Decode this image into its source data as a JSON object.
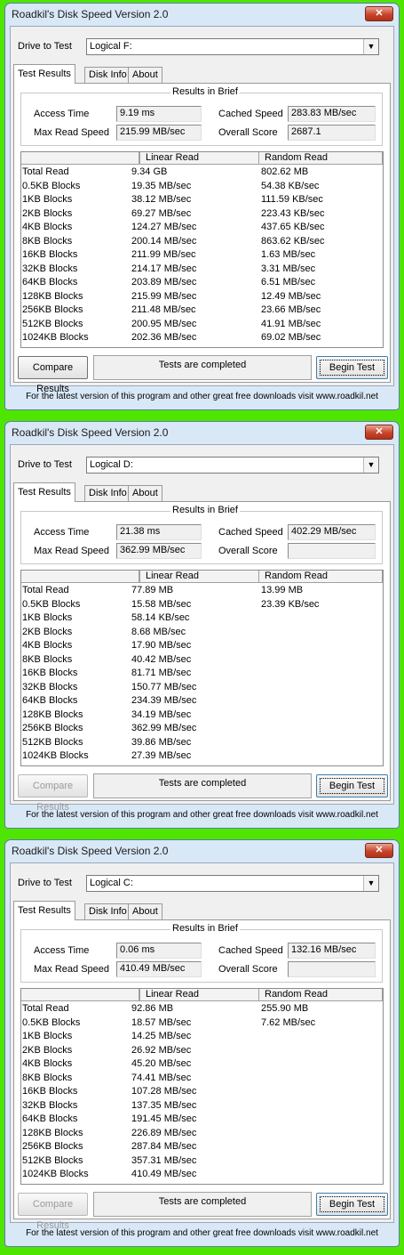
{
  "windows": [
    {
      "title": "Roadkil's Disk Speed Version 2.0",
      "close_icon": "close-x-icon",
      "drive_label": "Drive to Test",
      "drive_value": "Logical F:",
      "tabs": [
        "Test Results",
        "Disk Info",
        "About"
      ],
      "brief_title": "Results in Brief",
      "access_time_label": "Access Time",
      "access_time": "9.19 ms",
      "cached_speed_label": "Cached Speed",
      "cached_speed": "283.83 MB/sec",
      "max_read_label": "Max Read Speed",
      "max_read": "215.99 MB/sec",
      "overall_score_label": "Overall Score",
      "overall_score": "2687.1",
      "columns": [
        "",
        "Linear Read",
        "Random Read"
      ],
      "rows": [
        [
          "Total Read",
          "9.34 GB",
          "802.62 MB"
        ],
        [
          "0.5KB Blocks",
          "19.35 MB/sec",
          "54.38 KB/sec"
        ],
        [
          "1KB Blocks",
          "38.12 MB/sec",
          "111.59 KB/sec"
        ],
        [
          "2KB Blocks",
          "69.27 MB/sec",
          "223.43 KB/sec"
        ],
        [
          "4KB Blocks",
          "124.27 MB/sec",
          "437.65 KB/sec"
        ],
        [
          "8KB Blocks",
          "200.14 MB/sec",
          "863.62 KB/sec"
        ],
        [
          "16KB Blocks",
          "211.99 MB/sec",
          "1.63 MB/sec"
        ],
        [
          "32KB Blocks",
          "214.17 MB/sec",
          "3.31 MB/sec"
        ],
        [
          "64KB Blocks",
          "203.89 MB/sec",
          "6.51 MB/sec"
        ],
        [
          "128KB Blocks",
          "215.99 MB/sec",
          "12.49 MB/sec"
        ],
        [
          "256KB Blocks",
          "211.48 MB/sec",
          "23.66 MB/sec"
        ],
        [
          "512KB Blocks",
          "200.95 MB/sec",
          "41.91 MB/sec"
        ],
        [
          "1024KB Blocks",
          "202.36 MB/sec",
          "69.02 MB/sec"
        ]
      ],
      "compare_label": "Compare Results",
      "compare_enabled": true,
      "status": "Tests are completed",
      "begin_label": "Begin Test",
      "footer": "For the latest version of this program and other great free downloads visit www.roadkil.net"
    },
    {
      "title": "Roadkil's Disk Speed Version 2.0",
      "close_icon": "close-x-icon",
      "drive_label": "Drive to Test",
      "drive_value": "Logical D:",
      "tabs": [
        "Test Results",
        "Disk Info",
        "About"
      ],
      "brief_title": "Results in Brief",
      "access_time_label": "Access Time",
      "access_time": "21.38 ms",
      "cached_speed_label": "Cached Speed",
      "cached_speed": "402.29 MB/sec",
      "max_read_label": "Max Read Speed",
      "max_read": "362.99 MB/sec",
      "overall_score_label": "Overall Score",
      "overall_score": "",
      "columns": [
        "",
        "Linear Read",
        "Random Read"
      ],
      "rows": [
        [
          "Total Read",
          "77.89 MB",
          "13.99 MB"
        ],
        [
          "0.5KB Blocks",
          "15.58 MB/sec",
          "23.39 KB/sec"
        ],
        [
          "1KB Blocks",
          "58.14 KB/sec",
          ""
        ],
        [
          "2KB Blocks",
          "8.68 MB/sec",
          ""
        ],
        [
          "4KB Blocks",
          "17.90 MB/sec",
          ""
        ],
        [
          "8KB Blocks",
          "40.42 MB/sec",
          ""
        ],
        [
          "16KB Blocks",
          "81.71 MB/sec",
          ""
        ],
        [
          "32KB Blocks",
          "150.77 MB/sec",
          ""
        ],
        [
          "64KB Blocks",
          "234.39 MB/sec",
          ""
        ],
        [
          "128KB Blocks",
          "34.19 MB/sec",
          ""
        ],
        [
          "256KB Blocks",
          "362.99 MB/sec",
          ""
        ],
        [
          "512KB Blocks",
          "39.86 MB/sec",
          ""
        ],
        [
          "1024KB Blocks",
          "27.39 MB/sec",
          ""
        ]
      ],
      "compare_label": "Compare Results",
      "compare_enabled": false,
      "status": "Tests are completed",
      "begin_label": "Begin Test",
      "footer": "For the latest version of this program and other great free downloads visit www.roadkil.net"
    },
    {
      "title": "Roadkil's Disk Speed Version 2.0",
      "close_icon": "close-x-icon",
      "drive_label": "Drive to Test",
      "drive_value": "Logical C:",
      "tabs": [
        "Test Results",
        "Disk Info",
        "About"
      ],
      "brief_title": "Results in Brief",
      "access_time_label": "Access Time",
      "access_time": "0.06 ms",
      "cached_speed_label": "Cached Speed",
      "cached_speed": "132.16 MB/sec",
      "max_read_label": "Max Read Speed",
      "max_read": "410.49 MB/sec",
      "overall_score_label": "Overall Score",
      "overall_score": "",
      "columns": [
        "",
        "Linear Read",
        "Random Read"
      ],
      "rows": [
        [
          "Total Read",
          "92.86 MB",
          "255.90 MB"
        ],
        [
          "0.5KB Blocks",
          "18.57 MB/sec",
          "7.62 MB/sec"
        ],
        [
          "1KB Blocks",
          "14.25 MB/sec",
          ""
        ],
        [
          "2KB Blocks",
          "26.92 MB/sec",
          ""
        ],
        [
          "4KB Blocks",
          "45.20 MB/sec",
          ""
        ],
        [
          "8KB Blocks",
          "74.41 MB/sec",
          ""
        ],
        [
          "16KB Blocks",
          "107.28 MB/sec",
          ""
        ],
        [
          "32KB Blocks",
          "137.35 MB/sec",
          ""
        ],
        [
          "64KB Blocks",
          "191.45 MB/sec",
          ""
        ],
        [
          "128KB Blocks",
          "226.89 MB/sec",
          ""
        ],
        [
          "256KB Blocks",
          "287.84 MB/sec",
          ""
        ],
        [
          "512KB Blocks",
          "357.31 MB/sec",
          ""
        ],
        [
          "1024KB Blocks",
          "410.49 MB/sec",
          ""
        ]
      ],
      "compare_label": "Compare Results",
      "compare_enabled": false,
      "status": "Tests are completed",
      "begin_label": "Begin Test",
      "footer": "For the latest version of this program and other great free downloads visit www.roadkil.net"
    }
  ]
}
